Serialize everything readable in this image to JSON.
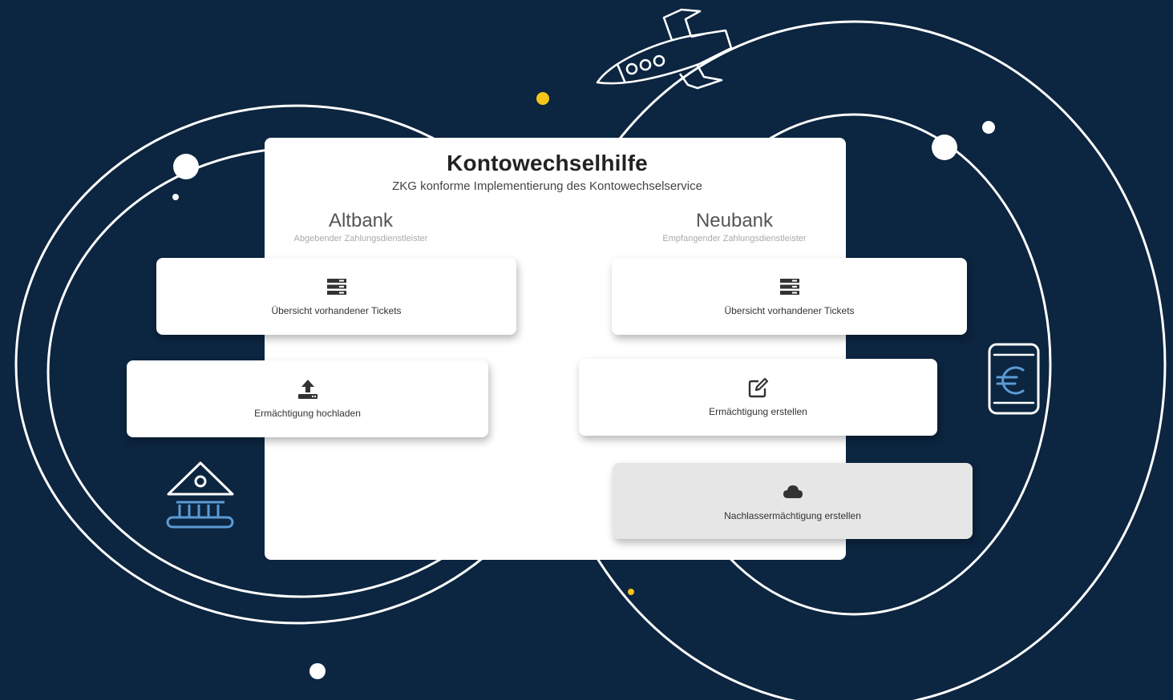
{
  "header": {
    "title": "Kontowechselhilfe",
    "subtitle": "ZKG konforme Implementierung des Kontowechselservice"
  },
  "altbank": {
    "title": "Altbank",
    "subtitle": "Abgebender Zahlungsdienstleister",
    "cards": [
      {
        "label": "Übersicht vorhandener Tickets",
        "icon": "server-icon"
      },
      {
        "label": "Ermächtigung hochladen",
        "icon": "upload-icon"
      }
    ]
  },
  "neubank": {
    "title": "Neubank",
    "subtitle": "Empfangender Zahlungsdienstleister",
    "cards": [
      {
        "label": "Übersicht vorhandener Tickets",
        "icon": "server-icon"
      },
      {
        "label": "Ermächtigung erstellen",
        "icon": "edit-icon"
      },
      {
        "label": "Nachlassermächtigung erstellen",
        "icon": "cloud-icon"
      }
    ]
  },
  "decor": {
    "icons": [
      "rocket-icon",
      "bank-icon",
      "phone-euro-icon"
    ],
    "colors": {
      "background": "#0c2540",
      "accent_yellow": "#f5c518",
      "accent_blue": "#5b9bd5"
    }
  }
}
